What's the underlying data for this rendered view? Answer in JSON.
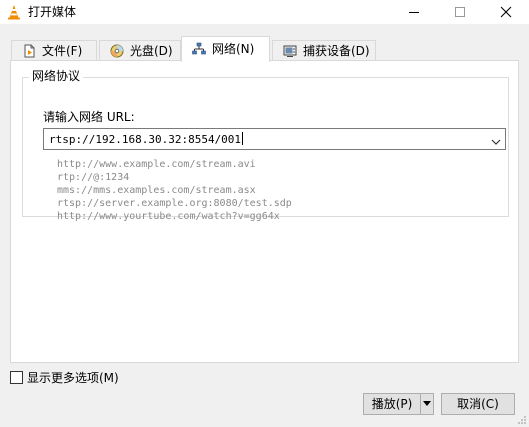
{
  "window": {
    "title": "打开媒体",
    "app_icon": "vlc-cone-icon",
    "controls": [
      "minimize-icon",
      "maximize-icon",
      "close-icon"
    ]
  },
  "tabs": [
    {
      "label": "文件(F)",
      "icon": "file-icon",
      "selected": false
    },
    {
      "label": "光盘(D)",
      "icon": "disc-icon",
      "selected": false
    },
    {
      "label": "网络(N)",
      "icon": "network-icon",
      "selected": true
    },
    {
      "label": "捕获设备(D)",
      "icon": "capture-device-icon",
      "selected": false
    }
  ],
  "network": {
    "group_title": "网络协议",
    "url_label": "请输入网络 URL:",
    "url_value": "rtsp://192.168.30.32:8554/001",
    "examples": [
      "http://www.example.com/stream.avi",
      "rtp://@:1234",
      "mms://mms.examples.com/stream.asx",
      "rtsp://server.example.org:8080/test.sdp",
      "http://www.yourtube.com/watch?v=gg64x"
    ]
  },
  "footer": {
    "more_options_label": "显示更多选项(M)",
    "more_options_checked": false,
    "play_label": "播放(P)",
    "cancel_label": "取消(C)"
  },
  "colors": {
    "vlc_orange": "#f08c00",
    "example_text": "#8a8a8a",
    "window_bg": "#f0f0f0"
  }
}
